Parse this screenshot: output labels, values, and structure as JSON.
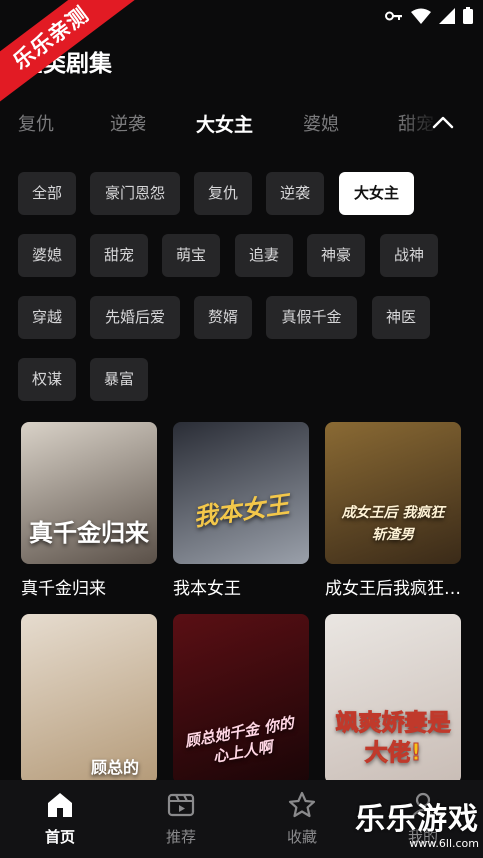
{
  "watermark": {
    "ribbon": "乐乐亲测",
    "logo": "乐乐游戏",
    "site": "www.6ll.com"
  },
  "page_title": "全类剧集",
  "tabs": [
    {
      "label": "复仇"
    },
    {
      "label": "逆袭"
    },
    {
      "label": "大女主",
      "active": true
    },
    {
      "label": "婆媳"
    },
    {
      "label": "甜宠"
    }
  ],
  "chips": [
    {
      "label": "全部"
    },
    {
      "label": "豪门恩怨"
    },
    {
      "label": "复仇"
    },
    {
      "label": "逆袭"
    },
    {
      "label": "大女主",
      "active": true
    },
    {
      "label": "婆媳"
    },
    {
      "label": "甜宠"
    },
    {
      "label": "萌宝"
    },
    {
      "label": "追妻"
    },
    {
      "label": "神豪"
    },
    {
      "label": "战神"
    },
    {
      "label": "穿越"
    },
    {
      "label": "先婚后爱"
    },
    {
      "label": "赘婿"
    },
    {
      "label": "真假千金"
    },
    {
      "label": "神医"
    },
    {
      "label": "权谋"
    },
    {
      "label": "暴富"
    }
  ],
  "dramas": [
    {
      "title": "真千金归来",
      "poster_text": "真千金归来",
      "poster_colors": [
        "#d9d2c8",
        "#5a5048"
      ],
      "text_color": "#ffffff"
    },
    {
      "title": "我本女王",
      "poster_text": "我本女王",
      "poster_colors": [
        "#2a2d36",
        "#9aa0aa"
      ],
      "text_color": "#f3c74a"
    },
    {
      "title": "成女王后我疯狂斩渣男",
      "poster_text": "成女王后 我疯狂斩渣男",
      "poster_colors": [
        "#8a6a34",
        "#3a2a18"
      ],
      "text_color": "#fff3d6"
    },
    {
      "title": "",
      "poster_text": "顾总的",
      "poster_colors": [
        "#e6dccf",
        "#b49a78"
      ],
      "text_color": "#ffffff"
    },
    {
      "title": "",
      "poster_text": "顾总她千金 你的心上人啊",
      "poster_colors": [
        "#5a0f14",
        "#1a0507"
      ],
      "text_color": "#ffd6e4"
    },
    {
      "title": "",
      "poster_text": "飒爽娇妻是大佬!",
      "poster_colors": [
        "#eae6e2",
        "#c9bdb6"
      ],
      "text_color": "#f7c21a"
    }
  ],
  "bottom_nav": [
    {
      "label": "首页",
      "icon": "home-icon",
      "active": true
    },
    {
      "label": "推荐",
      "icon": "video-icon"
    },
    {
      "label": "收藏",
      "icon": "star-icon"
    },
    {
      "label": "我的",
      "icon": "user-icon"
    }
  ]
}
